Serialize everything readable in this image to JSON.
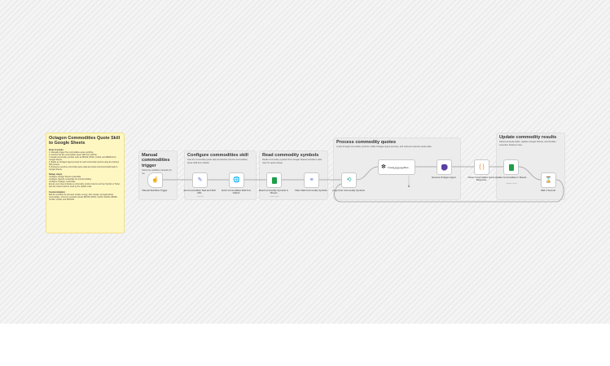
{
  "main_note": {
    "title": "Octagon Commodities Quote Skill to Google Sheets",
    "how_heading": "How it works",
    "how_items": [
      "1. Manually trigger the commodities quote workflow.",
      "2. Fetches the live commodities quote Skill from GitHub.",
      "3. Reads commodity symbols such as RD100, RH20, CL100, and RB100 from Google Sheets.",
      "4. Builds an Octagon Agent prompt for each commodity symbol using the fetched Skill content.",
      "5. Retrieves real-time commodity quote data and writes structured fields back to Google Sheets."
    ],
    "setup_heading": "Setup steps",
    "setup_items": [
      "Configure Google Sheets credentials.",
      "Configure OpenAI credentials for prompt building.",
      "Configure Octagon credentials.",
      "Ensure your sheet includes a commodity symbol column such as Symbol or Ticker, plus the output columns used by the update node."
    ],
    "custom_heading": "Customization",
    "custom_text": "Edit the workflow for precious metals, energy, farm metals, and agricultural commodities. Common symbols include RD100, RH20, CL100, NG100, RB100, CC100, OJ100, and PRG100."
  },
  "stickies": {
    "trigger": {
      "title": "Manual commodities trigger",
      "desc": "Starts the workflow manually for run"
    },
    "skill": {
      "title": "Configure commodities skill",
      "desc": "Sets the commodity quote task and fetches the live commodities quote Skill from GitHub."
    },
    "read": {
      "title": "Read commodity symbols",
      "desc": "Reads commodity symbols from Google Sheets and filters valid rows for quote lookup."
    },
    "process": {
      "title": "Process commodity quotes",
      "desc": "Loops through commodity symbols, builds Octagon Agent prompts, and retrieves real-time quote data."
    },
    "update": {
      "title": "Update commodity results",
      "desc": "Parses all quote fields, updates Google Sheets, and throttles execution between rows."
    }
  },
  "nodes": {
    "manual": {
      "label": "Manual Workflow Trigger",
      "icon": "pointer-icon"
    },
    "set_task": {
      "label": "Set Commodities Task and Skill URL",
      "sub": "manual",
      "icon": "pencil-icon"
    },
    "fetch": {
      "label": "Fetch Commodities Skill from GitHub",
      "icon": "globe-icon"
    },
    "read_sheet": {
      "label": "Read Commodity Symbols in Sheets",
      "sub": "read: sheet",
      "icon": "sheet-icon"
    },
    "filter": {
      "label": "Filter Valid Commodity Symbols",
      "icon": "filter-icon"
    },
    "loop": {
      "label": "Loop Over Commodity Symbols",
      "icon": "loop-icon"
    },
    "create": {
      "label": "Create Commodities...",
      "sub": "Request Full",
      "icon": "openai-icon"
    },
    "execute": {
      "label": "Execute Octagon Agent",
      "icon": "octagon-icon"
    },
    "parse": {
      "label": "Parse Commodities Quote Response",
      "icon": "braces-icon"
    },
    "update_sheet": {
      "label": "Update Commodities in Sheets",
      "sub": "update: sheet",
      "icon": "sheet-icon"
    },
    "wait": {
      "label": "Wait 1 Second",
      "icon": "hourglass-icon"
    }
  }
}
